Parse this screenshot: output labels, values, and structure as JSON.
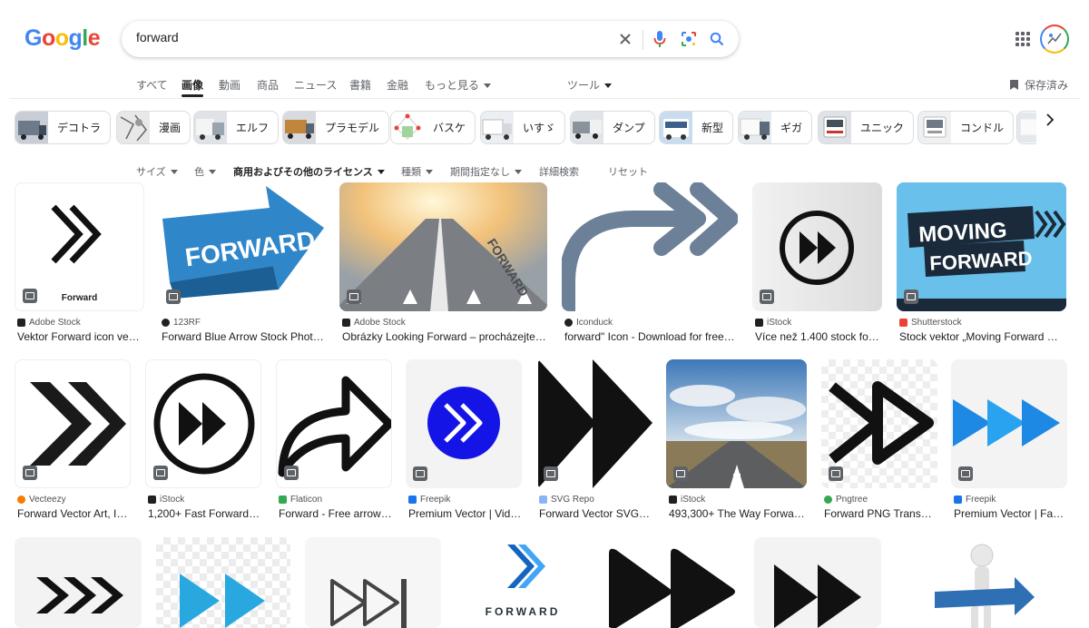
{
  "logo": {
    "letters": [
      "G",
      "o",
      "o",
      "g",
      "l",
      "e"
    ]
  },
  "search": {
    "query": "forward"
  },
  "tabs": [
    "すべて",
    "画像",
    "動画",
    "商品",
    "ニュース",
    "書籍",
    "金融",
    "もっと見る"
  ],
  "tools_label": "ツール",
  "saved_label": "保存済み",
  "chips": [
    "デコトラ",
    "漫画",
    "エルフ",
    "プラモデル",
    "バスケ",
    "いすゞ",
    "ダンプ",
    "新型",
    "ギガ",
    "ユニック",
    "コンドル"
  ],
  "filters": {
    "size": "サイズ",
    "color": "色",
    "license": "商用およびその他のライセンス",
    "type": "種類",
    "time": "期間指定なし",
    "advanced": "詳細検索",
    "reset": "リセット"
  },
  "results_row1": [
    {
      "source": "Adobe Stock",
      "title": "Vektor Forward icon vect…",
      "img_text": "Forward",
      "fav": "#202124"
    },
    {
      "source": "123RF",
      "title": "Forward Blue Arrow Stock Photo…",
      "img_text": "FORWARD",
      "fav": "#202124"
    },
    {
      "source": "Adobe Stock",
      "title": "Obrázky Looking Forward – procházejte f…",
      "img_text": "FORWARD",
      "fav": "#202124"
    },
    {
      "source": "Iconduck",
      "title": "forward\" Icon - Download for free –…",
      "fav": "#202124"
    },
    {
      "source": "iStock",
      "title": "Více než 1.400 stock fot…",
      "fav": "#202124"
    },
    {
      "source": "Shutterstock",
      "title": "Stock vektor „Moving Forward Wo…",
      "img_text_1": "MOVING",
      "img_text_2": "FORWARD",
      "fav": "#ea4335"
    }
  ],
  "results_row2": [
    {
      "source": "Vecteezy",
      "title": "Forward Vector Art, Ic…",
      "fav": "#f57c00"
    },
    {
      "source": "iStock",
      "title": "1,200+ Fast Forward …",
      "fav": "#202124"
    },
    {
      "source": "Flaticon",
      "title": "Forward - Free arrow…",
      "fav": "#34a853"
    },
    {
      "source": "Freepik",
      "title": "Premium Vector | Vid…",
      "fav": "#1a73e8"
    },
    {
      "source": "SVG Repo",
      "title": "Forward Vector SVG …",
      "fav": "#8ab4f8"
    },
    {
      "source": "iStock",
      "title": "493,300+ The Way Forwar…",
      "fav": "#202124"
    },
    {
      "source": "Pngtree",
      "title": "Forward PNG Transp…",
      "fav": "#34a853"
    },
    {
      "source": "Freepik",
      "title": "Premium Vector | Fas…",
      "fav": "#1a73e8"
    }
  ],
  "results_row3": [
    {
      "img_text": ""
    },
    {
      "img_text": ""
    },
    {
      "img_text": ""
    },
    {
      "img_text": "FORWARD"
    },
    {
      "img_text": ""
    },
    {
      "img_text": ""
    },
    {
      "img_text": ""
    }
  ],
  "colors": {
    "blue": "#4285f4",
    "red": "#ea4335",
    "yellow": "#fbbc05",
    "green": "#34a853",
    "text": "#202124",
    "muted": "#5f6368"
  }
}
